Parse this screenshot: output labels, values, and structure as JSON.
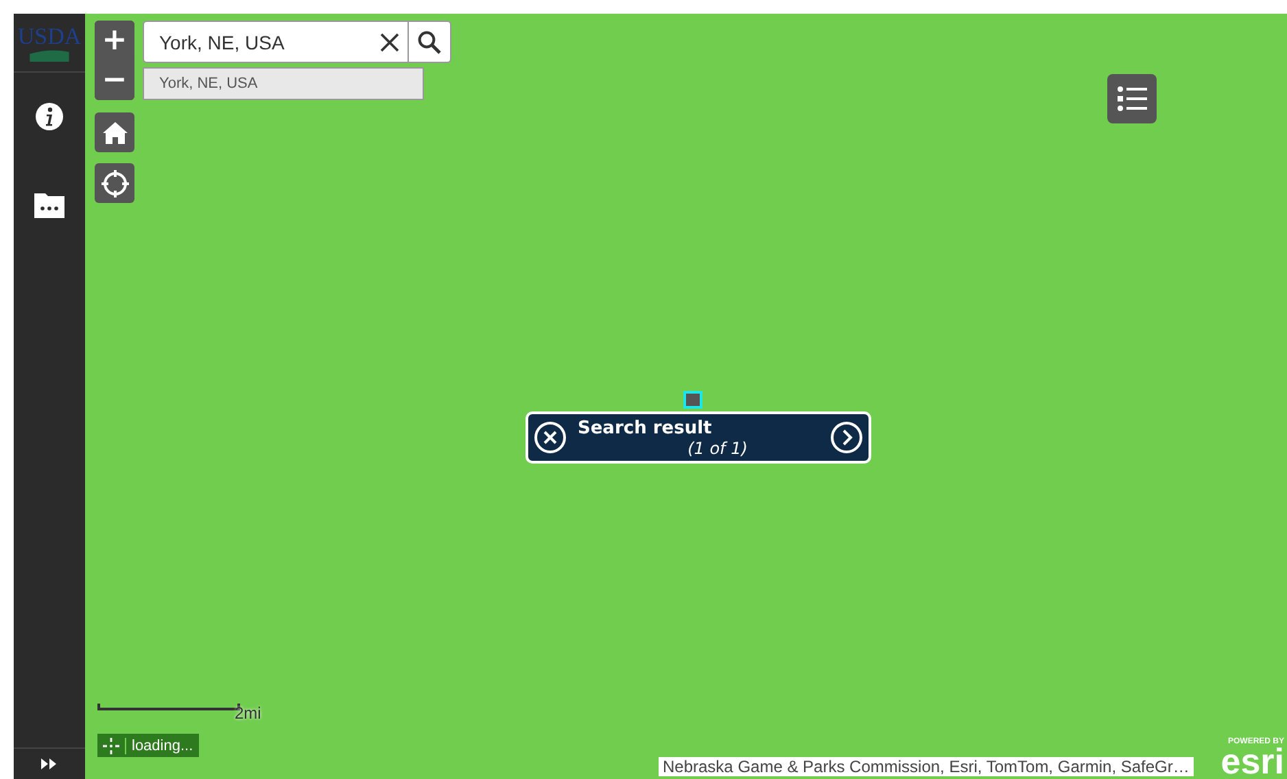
{
  "logo": {
    "text": "USDA"
  },
  "search": {
    "value": "York, NE, USA"
  },
  "suggestions": [
    "York, NE, USA"
  ],
  "zoom_buttons": [
    {
      "label": "+"
    },
    {
      "label": "−"
    }
  ],
  "popup": {
    "title": "Search result",
    "count": "(1 of 1)"
  },
  "scale": {
    "label": "2mi"
  },
  "status": {
    "text": "loading..."
  },
  "attribution": {
    "text": "Nebraska Game & Parks Commission, Esri, TomTom, Garmin, SafeGr…"
  },
  "esri": {
    "caption": "POWERED BY",
    "text": "esri"
  }
}
